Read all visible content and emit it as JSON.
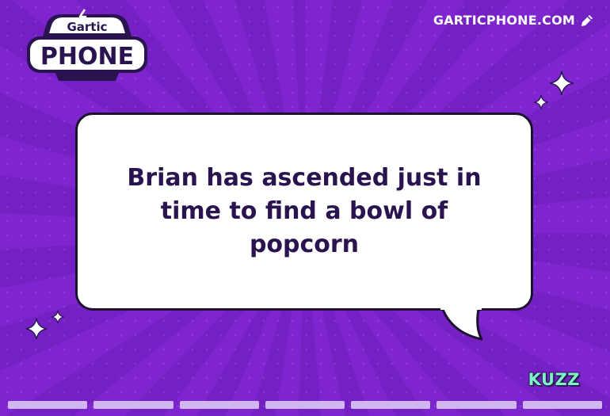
{
  "logo": {
    "line1": "Gartic",
    "line2": "PHONE"
  },
  "header": {
    "site_label": "GARTICPHONE.COM",
    "site_icon": "edit-pencil-icon"
  },
  "bubble": {
    "text": "Brian has ascended just in time to find a bowl of popcorn"
  },
  "footer": {
    "brand": "KUZZ"
  },
  "progress": {
    "total_segments": 7,
    "filled_segments": 7
  },
  "colors": {
    "background": "#7a22c8",
    "bubble": "#ffffff",
    "text": "#2a1450",
    "brand": "#7ff0c8",
    "progress": "#d0b6f2"
  }
}
